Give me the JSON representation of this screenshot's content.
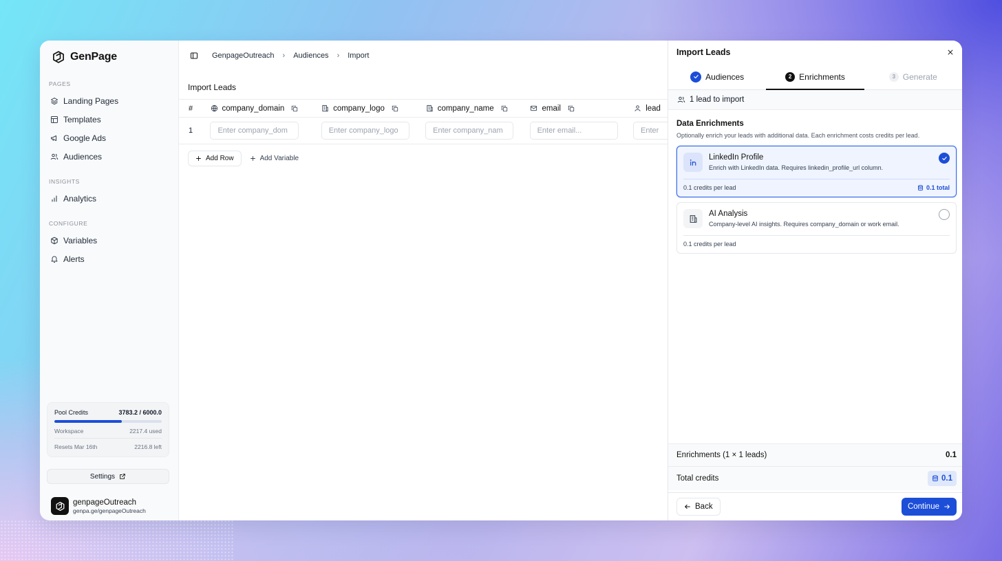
{
  "brand": {
    "name": "GenPage"
  },
  "sidebar": {
    "sections": [
      {
        "label": "PAGES",
        "items": [
          {
            "label": "Landing Pages",
            "icon": "layers-icon"
          },
          {
            "label": "Templates",
            "icon": "layout-icon"
          },
          {
            "label": "Google Ads",
            "icon": "megaphone-icon"
          },
          {
            "label": "Audiences",
            "icon": "users-icon"
          }
        ]
      },
      {
        "label": "INSIGHTS",
        "items": [
          {
            "label": "Analytics",
            "icon": "bar-chart-icon"
          }
        ]
      },
      {
        "label": "CONFIGURE",
        "items": [
          {
            "label": "Variables",
            "icon": "cube-icon"
          },
          {
            "label": "Alerts",
            "icon": "bell-icon"
          }
        ]
      }
    ],
    "credits": {
      "label": "Pool Credits",
      "value": "3783.2 / 6000.0",
      "progress": 0.6305,
      "workspace_label": "Workspace",
      "workspace_value": "2217.4 used",
      "resets_label": "Resets Mar 16th",
      "resets_value": "2216.8 left"
    },
    "settings_label": "Settings",
    "account": {
      "name": "genpageOutreach",
      "url": "genpa.ge/genpageOutreach"
    }
  },
  "breadcrumb": [
    "GenpageOutreach",
    "Audiences",
    "Import"
  ],
  "main": {
    "title": "Import Leads",
    "table": {
      "num_header": "#",
      "columns": [
        {
          "name": "company_domain",
          "icon": "globe-icon",
          "placeholder": "Enter company_dom"
        },
        {
          "name": "company_logo",
          "icon": "building-icon",
          "placeholder": "Enter company_logo"
        },
        {
          "name": "company_name",
          "icon": "building-icon",
          "placeholder": "Enter company_nam"
        },
        {
          "name": "email",
          "icon": "mail-icon",
          "placeholder": "Enter email..."
        },
        {
          "name": "lead",
          "icon": "user-icon",
          "placeholder": "Enter"
        }
      ],
      "row_number": "1"
    },
    "add_row_label": "Add Row",
    "add_variable_label": "Add Variable"
  },
  "panel": {
    "title": "Import Leads",
    "steps": [
      {
        "label": "Audiences",
        "state": "done"
      },
      {
        "label": "Enrichments",
        "state": "active",
        "number": "2"
      },
      {
        "label": "Generate",
        "state": "disabled",
        "number": "3"
      }
    ],
    "lead_count": "1 lead to import",
    "enrichments_title": "Data Enrichments",
    "enrichments_desc": "Optionally enrich your leads with additional data. Each enrichment costs credits per lead.",
    "options": [
      {
        "name": "LinkedIn Profile",
        "desc": "Enrich with LinkedIn data. Requires linkedin_profile_url column.",
        "cost": "0.1 credits per lead",
        "total": "0.1 total",
        "selected": true,
        "icon": "linkedin-icon"
      },
      {
        "name": "AI Analysis",
        "desc": "Company-level AI insights. Requires company_domain or work email.",
        "cost": "0.1 credits per lead",
        "selected": false,
        "icon": "building-icon"
      }
    ],
    "summary": {
      "enrichments_label": "Enrichments (1 × 1 leads)",
      "enrichments_value": "0.1",
      "total_label": "Total credits",
      "total_value": "0.1"
    },
    "back_label": "Back",
    "continue_label": "Continue"
  },
  "colors": {
    "accent": "#1d4ed8",
    "selected_bg": "#eff4fe"
  }
}
